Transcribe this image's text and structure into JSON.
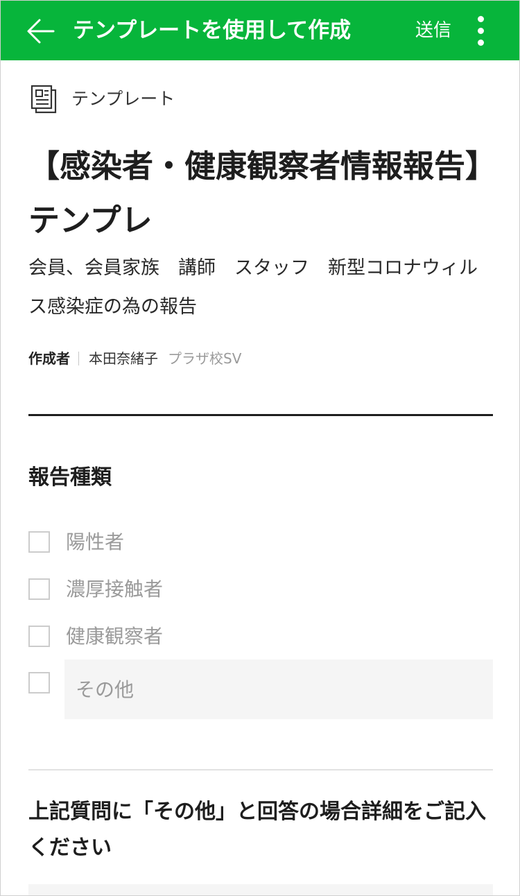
{
  "header": {
    "title": "テンプレートを使用して作成",
    "send_label": "送信",
    "back_icon": "arrow-left-icon",
    "more_icon": "vertical-ellipsis-icon",
    "background_color": "#07b53b"
  },
  "template": {
    "label": "テンプレート",
    "icon": "document-stack-icon",
    "title": "【感染者・健康観察者情報報告】テンプレ",
    "description": "会員、会員家族　講師　スタッフ　新型コロナウィルス感染症の為の報告",
    "author_label": "作成者",
    "author_name": "本田奈緒子",
    "author_org": "プラザ校SV"
  },
  "question1": {
    "title": "報告種類",
    "options": [
      {
        "label": "陽性者",
        "checked": false
      },
      {
        "label": "濃厚接触者",
        "checked": false
      },
      {
        "label": "健康観察者",
        "checked": false
      }
    ],
    "other_placeholder": "その他"
  },
  "question2": {
    "title": "上記質問に「その他」と回答の場合詳細をご記入ください"
  }
}
